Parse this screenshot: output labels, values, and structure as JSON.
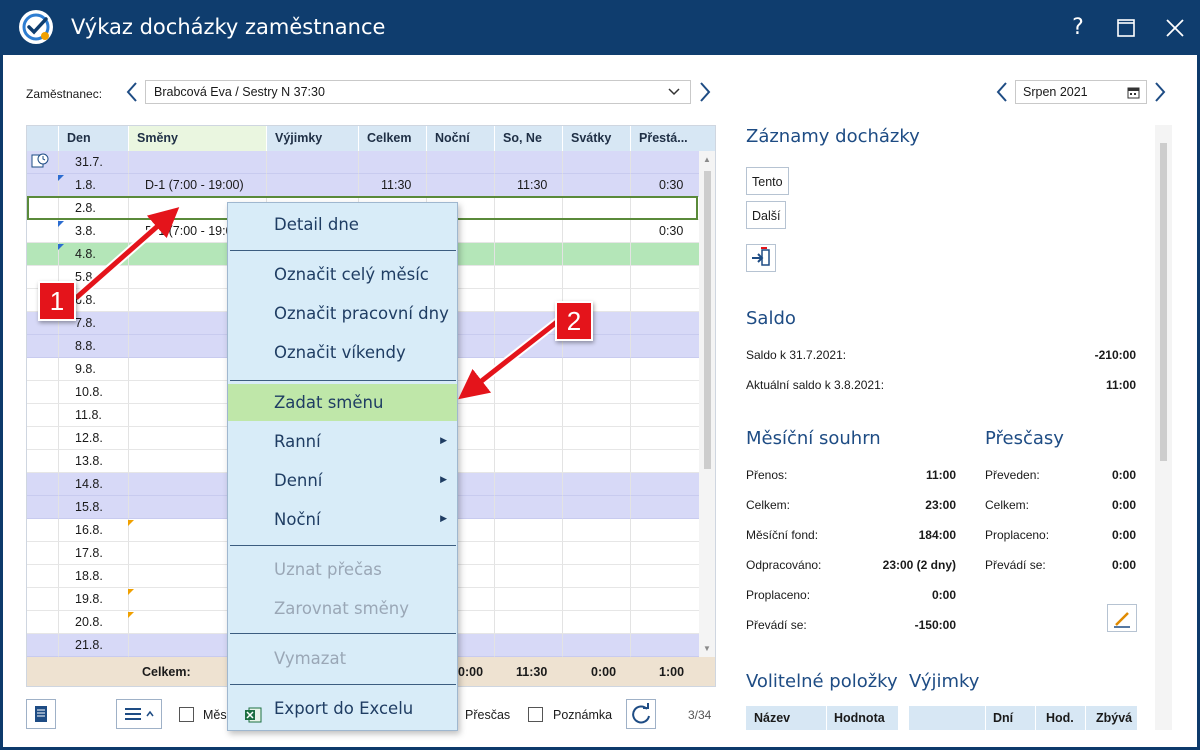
{
  "window": {
    "title": "Výkaz docházky zaměstnance",
    "help_label": "?",
    "maximize_label": "☐",
    "close_label": "✕"
  },
  "employee": {
    "label": "Zaměstnanec:",
    "value": "Brabcová Eva / Sestry N 37:30"
  },
  "month": {
    "value": "Srpen 2021"
  },
  "grid": {
    "columns": [
      "Den",
      "Směny",
      "Výjimky",
      "Celkem",
      "Noční",
      "So, Ne",
      "Svátky",
      "Přestá..."
    ],
    "rows": [
      {
        "den": "31.7.",
        "smeny": "",
        "celkem": "",
        "so_ne": "",
        "prest": "",
        "type": "weekend"
      },
      {
        "den": "1.8.",
        "smeny": "D-1 (7:00 - 19:00)",
        "celkem": "11:30",
        "so_ne": "11:30",
        "prest": "0:30",
        "type": "weekend"
      },
      {
        "den": "2.8.",
        "smeny": "",
        "celkem": "",
        "so_ne": "",
        "prest": "",
        "type": "plain"
      },
      {
        "den": "3.8.",
        "smeny": "D-1 (7:00 - 19:0",
        "celkem": "",
        "so_ne": "",
        "prest": "0:30",
        "type": "plain"
      },
      {
        "den": "4.8.",
        "smeny": "",
        "celkem": "",
        "so_ne": "",
        "prest": "",
        "type": "green"
      },
      {
        "den": "5.8.",
        "smeny": "",
        "type": "plain"
      },
      {
        "den": "6.8.",
        "smeny": "",
        "type": "plain"
      },
      {
        "den": "7.8.",
        "smeny": "",
        "type": "weekend"
      },
      {
        "den": "8.8.",
        "smeny": "",
        "type": "weekend"
      },
      {
        "den": "9.8.",
        "smeny": "",
        "type": "plain"
      },
      {
        "den": "10.8.",
        "smeny": "",
        "type": "plain"
      },
      {
        "den": "11.8.",
        "smeny": "",
        "type": "plain"
      },
      {
        "den": "12.8.",
        "smeny": "",
        "type": "plain"
      },
      {
        "den": "13.8.",
        "smeny": "",
        "type": "plain"
      },
      {
        "den": "14.8.",
        "smeny": "",
        "type": "weekend"
      },
      {
        "den": "15.8.",
        "smeny": "",
        "type": "weekend"
      },
      {
        "den": "16.8.",
        "smeny": "",
        "type": "plain"
      },
      {
        "den": "17.8.",
        "smeny": "",
        "type": "plain"
      },
      {
        "den": "18.8.",
        "smeny": "",
        "type": "plain"
      },
      {
        "den": "19.8.",
        "smeny": "",
        "type": "plain"
      },
      {
        "den": "20.8.",
        "smeny": "",
        "type": "plain"
      },
      {
        "den": "21.8.",
        "smeny": "",
        "type": "weekend"
      }
    ],
    "footer": {
      "label": "Celkem:",
      "nocni": "0:00",
      "so_ne": "11:30",
      "svatky": "0:00",
      "prest": "1:00"
    }
  },
  "toolbar": {
    "mesic_label": "Měs",
    "prescas_label": "Přesčas",
    "poznamka_label": "Poznámka",
    "page_count": "3/34"
  },
  "context_menu": {
    "items": [
      {
        "label": "Detail dne",
        "enabled": true
      },
      {
        "label": "Označit celý měsíc",
        "enabled": true
      },
      {
        "label": "Označit pracovní dny",
        "enabled": true
      },
      {
        "label": "Označit víkendy",
        "enabled": true
      },
      {
        "label": "Zadat směnu",
        "enabled": true,
        "highlight": true
      },
      {
        "label": "Ranní",
        "enabled": true,
        "submenu": true
      },
      {
        "label": "Denní",
        "enabled": true,
        "submenu": true
      },
      {
        "label": "Noční",
        "enabled": true,
        "submenu": true
      },
      {
        "label": "Uznat přečas",
        "enabled": false
      },
      {
        "label": "Zarovnat směny",
        "enabled": false
      },
      {
        "label": "Vymazat",
        "enabled": false
      },
      {
        "label": "Export do Excelu",
        "enabled": true
      }
    ],
    "submenu_glyph": "▶"
  },
  "records": {
    "title": "Záznamy docházky",
    "btn_tento": "Tento",
    "btn_dalsi": "Další"
  },
  "saldo": {
    "title": "Saldo",
    "items": [
      {
        "label": "Saldo k 31.7.2021:",
        "value": "-210:00"
      },
      {
        "label": "Aktuální saldo k 3.8.2021:",
        "value": "11:00"
      }
    ]
  },
  "monthly": {
    "title": "Měsíční souhrn",
    "items": [
      {
        "label": "Přenos:",
        "value": "11:00"
      },
      {
        "label": "Celkem:",
        "value": "23:00"
      },
      {
        "label": "Měsíční fond:",
        "value": "184:00"
      },
      {
        "label": "Odpracováno:",
        "value": "23:00 (2 dny)"
      },
      {
        "label": "Proplaceno:",
        "value": "0:00"
      },
      {
        "label": "Převádí se:",
        "value": "-150:00"
      }
    ]
  },
  "overtime": {
    "title": "Přesčasy",
    "items": [
      {
        "label": "Převeden:",
        "value": "0:00"
      },
      {
        "label": "Celkem:",
        "value": "0:00"
      },
      {
        "label": "Proplaceno:",
        "value": "0:00"
      },
      {
        "label": "Převádí se:",
        "value": "0:00"
      }
    ]
  },
  "optional": {
    "title": "Volitelné položky",
    "col_name": "Název",
    "col_value": "Hodnota"
  },
  "exceptions": {
    "title": "Výjimky",
    "col_days": "Dní",
    "col_hours": "Hod.",
    "col_left": "Zbývá"
  },
  "annotations": {
    "badge1": "1",
    "badge2": "2"
  },
  "colors": {
    "titlebar": "#0f3d6e",
    "weekend_row": "#d7d9f7",
    "green_row": "#b4e6b8",
    "menu_bg": "#d8ecf8",
    "menu_highlight": "#bfe7a9",
    "badge": "#e4141b"
  }
}
